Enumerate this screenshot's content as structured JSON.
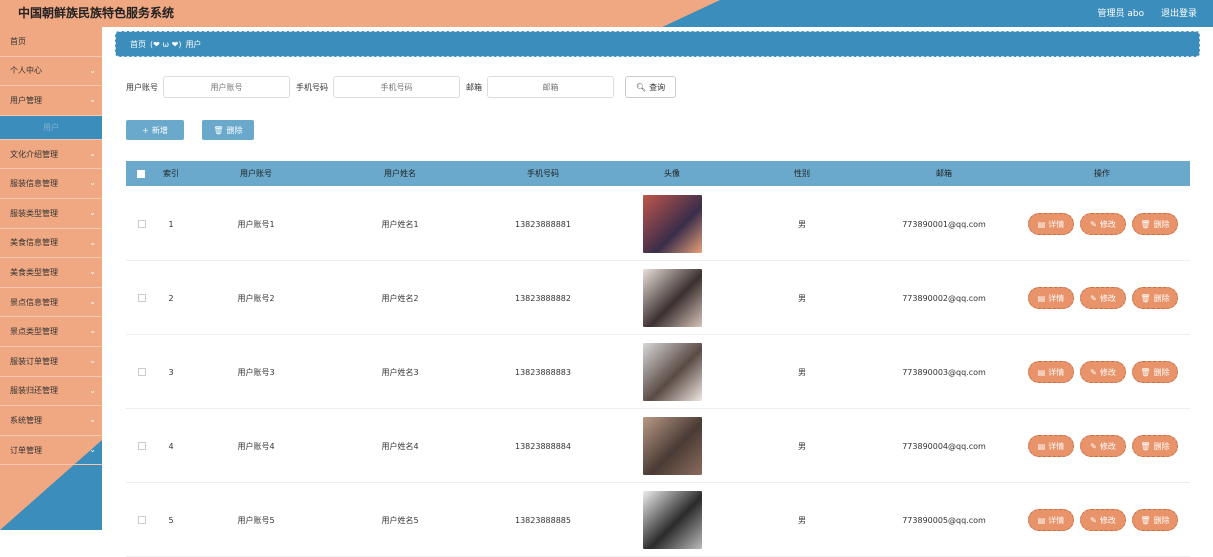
{
  "header": {
    "title": "中国朝鲜族民族特色服务系统",
    "user": "管理员 abo",
    "logout": "退出登录"
  },
  "sidebar": {
    "items": [
      {
        "label": "首页",
        "chevron": false
      },
      {
        "label": "个人中心",
        "chevron": true
      },
      {
        "label": "用户管理",
        "chevron": true
      },
      {
        "label": "用户",
        "sub": true
      },
      {
        "label": "文化介绍管理",
        "chevron": true
      },
      {
        "label": "服装信息管理",
        "chevron": true
      },
      {
        "label": "服装类型管理",
        "chevron": true
      },
      {
        "label": "美食信息管理",
        "chevron": true
      },
      {
        "label": "美食类型管理",
        "chevron": true
      },
      {
        "label": "景点信息管理",
        "chevron": true
      },
      {
        "label": "景点类型管理",
        "chevron": true
      },
      {
        "label": "服装订单管理",
        "chevron": true
      },
      {
        "label": "服装归还管理",
        "chevron": true
      },
      {
        "label": "系统管理",
        "chevron": true
      },
      {
        "label": "订单管理",
        "chevron": true
      }
    ]
  },
  "breadcrumb": {
    "home": "首页",
    "deco": "(❤ ω ❤)",
    "current": "用户"
  },
  "search": {
    "account_label": "用户账号",
    "account_placeholder": "用户账号",
    "phone_label": "手机号码",
    "phone_placeholder": "手机号码",
    "email_label": "邮箱",
    "email_placeholder": "邮箱",
    "query_button": "查询"
  },
  "actions": {
    "add": "新增",
    "delete": "删除"
  },
  "table": {
    "headers": [
      "索引",
      "用户账号",
      "用户姓名",
      "手机号码",
      "头像",
      "性别",
      "邮箱",
      "操作"
    ],
    "op_detail": "详情",
    "op_edit": "修改",
    "op_delete": "删除",
    "rows": [
      {
        "index": "1",
        "account": "用户账号1",
        "name": "用户姓名1",
        "phone": "13823888881",
        "gender": "男",
        "email": "773890001@qq.com"
      },
      {
        "index": "2",
        "account": "用户账号2",
        "name": "用户姓名2",
        "phone": "13823888882",
        "gender": "男",
        "email": "773890002@qq.com"
      },
      {
        "index": "3",
        "account": "用户账号3",
        "name": "用户姓名3",
        "phone": "13823888883",
        "gender": "男",
        "email": "773890003@qq.com"
      },
      {
        "index": "4",
        "account": "用户账号4",
        "name": "用户姓名4",
        "phone": "13823888884",
        "gender": "男",
        "email": "773890004@qq.com"
      },
      {
        "index": "5",
        "account": "用户账号5",
        "name": "用户姓名5",
        "phone": "13823888885",
        "gender": "男",
        "email": "773890005@qq.com"
      }
    ]
  },
  "colors": {
    "peach": "#f0a882",
    "blue": "#3b8dbb",
    "table_header": "#6aa9cc",
    "op_button": "#e8936a"
  }
}
